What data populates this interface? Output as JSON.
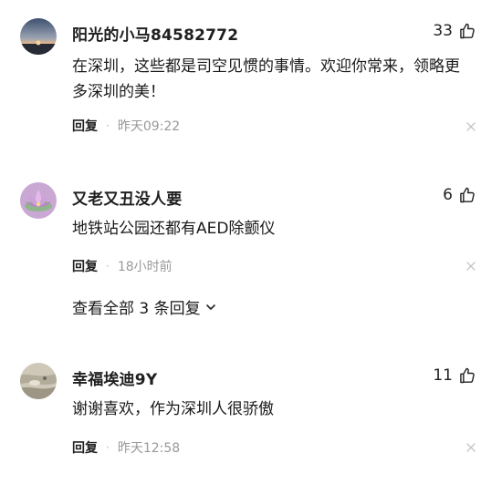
{
  "comments": [
    {
      "username": "阳光的小马84582772",
      "likes": "33",
      "text": "在深圳，这些都是司空见惯的事情。欢迎你常来，领略更多深圳的美！",
      "reply_label": "回复",
      "dot": "·",
      "time": "昨天09:22",
      "avatar_icon": "sunset-avatar-icon"
    },
    {
      "username": "又老又丑没人要",
      "likes": "6",
      "text": "地铁站公园还都有AED除颤仪",
      "reply_label": "回复",
      "dot": "·",
      "time": "18小时前",
      "avatar_icon": "lotus-avatar-icon",
      "view_all": "查看全部 3 条回复"
    },
    {
      "username": "幸福埃迪9Y",
      "likes": "11",
      "text": "谢谢喜欢，作为深圳人很骄傲",
      "reply_label": "回复",
      "dot": "·",
      "time": "昨天12:58",
      "avatar_icon": "sand-avatar-icon"
    }
  ],
  "colors": {
    "text": "#1a1a1a",
    "muted": "#999999",
    "icon": "#222222"
  }
}
